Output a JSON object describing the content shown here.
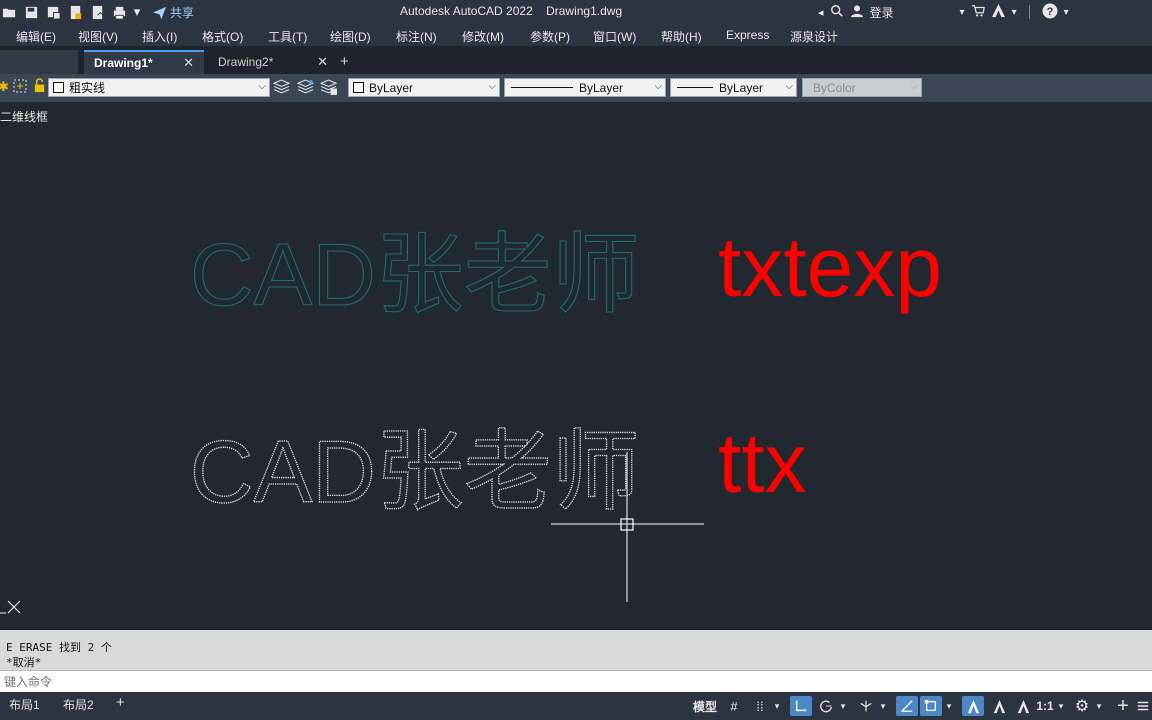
{
  "title_bar": {
    "share_label": "共享",
    "app_title": "Autodesk AutoCAD 2022    Drawing1.dwg",
    "login_label": "登录"
  },
  "menu": [
    "编辑(E)",
    "视图(V)",
    "插入(I)",
    "格式(O)",
    "工具(T)",
    "绘图(D)",
    "标注(N)",
    "修改(M)",
    "参数(P)",
    "窗口(W)",
    "帮助(H)",
    "Express",
    "源泉设计"
  ],
  "tabs": [
    {
      "label": "Drawing1*",
      "active": true
    },
    {
      "label": "Drawing2*",
      "active": false
    }
  ],
  "properties": {
    "layer": "粗实线",
    "color": "ByLayer",
    "linetype": "ByLayer",
    "lineweight": "ByLayer",
    "plot_style": "ByColor"
  },
  "viewport": {
    "view_label": "二维线框",
    "text_outline_top": "CAD张老师",
    "text_top_red": "txtexp",
    "text_outline_bottom": "CAD张老师",
    "text_bottom_red": "ttx",
    "colors": {
      "outline_top": "#1f6f6a",
      "outline_bottom": "#e9e9e9",
      "red": "#ff0000"
    }
  },
  "command": {
    "history": [
      "E ERASE 找到 2 个",
      "*取消*"
    ],
    "placeholder": "键入命令"
  },
  "status": {
    "layout_tabs": [
      "布局1",
      "布局2"
    ],
    "model_label": "模型",
    "scale": "1:1"
  }
}
